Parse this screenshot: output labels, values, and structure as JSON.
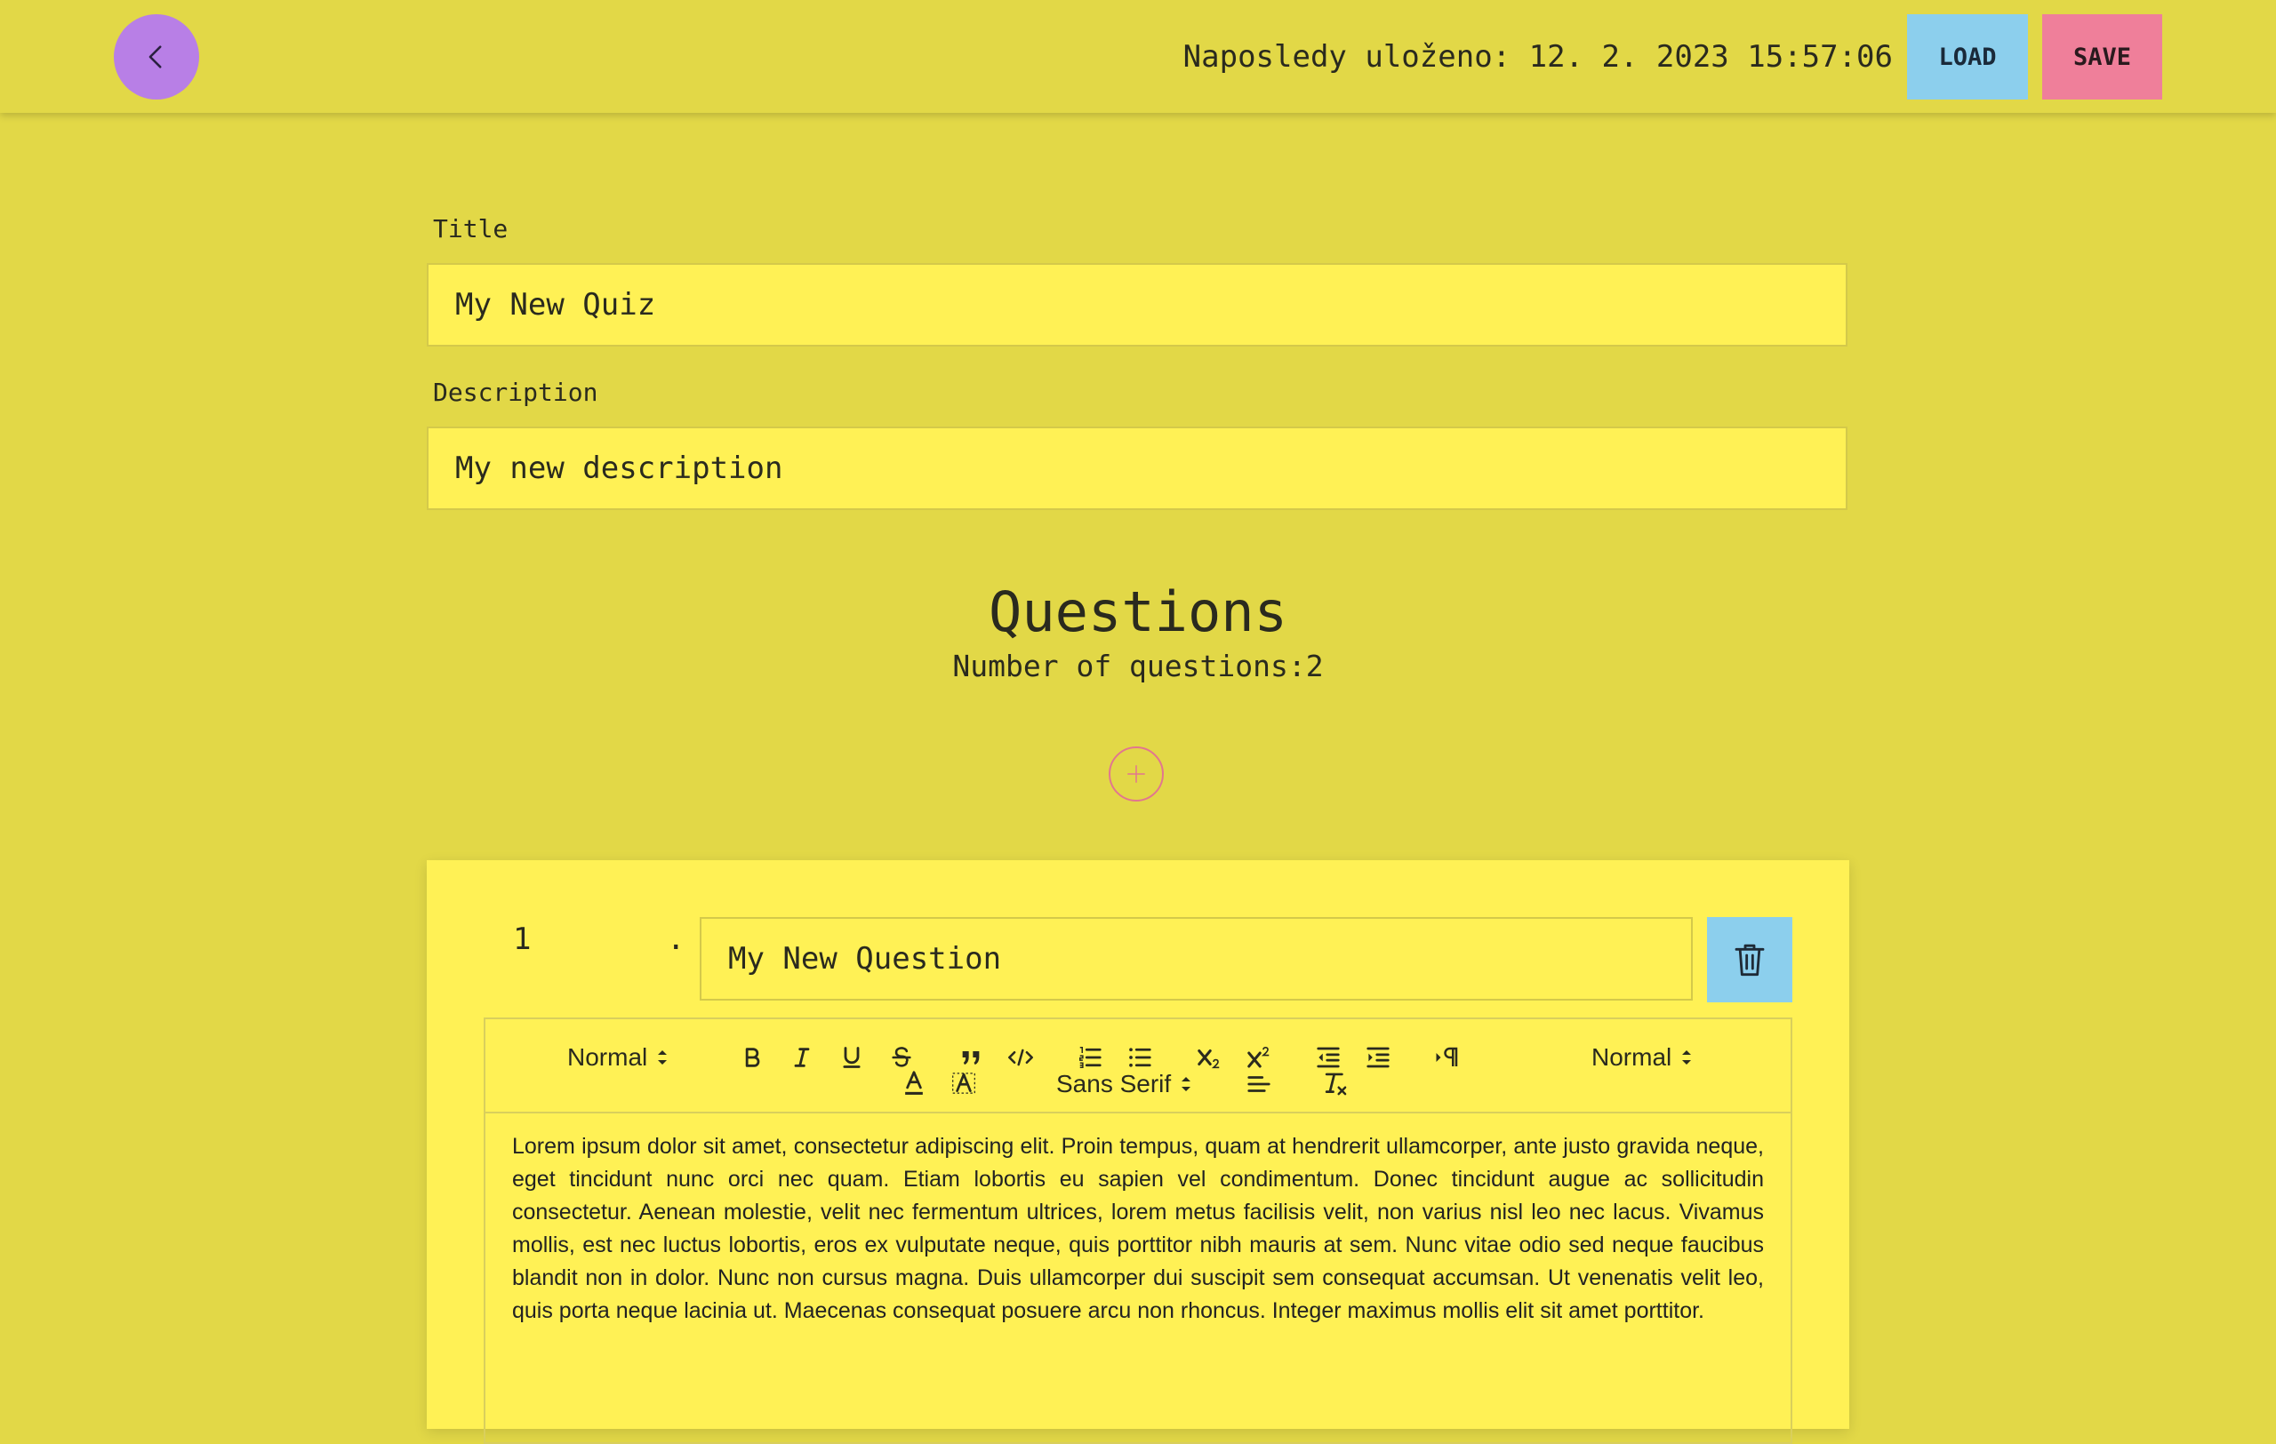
{
  "header": {
    "back_icon": "chevron-left-icon",
    "last_saved": "Naposledy uloženo: 12. 2. 2023 15:57:06",
    "load_label": "LOAD",
    "save_label": "SAVE",
    "colors": {
      "background": "#e2d847",
      "back": "#b87fe6",
      "load": "#8ccfed",
      "save": "#ef7f9a"
    }
  },
  "form": {
    "title_label": "Title",
    "title_value": "My New Quiz",
    "description_label": "Description",
    "description_value": "My new description"
  },
  "questions": {
    "heading": "Questions",
    "count_text": "Number of questions:2",
    "add_icon": "plus-icon"
  },
  "question_items": [
    {
      "number": "1",
      "dot": ".",
      "title": "My New Question",
      "delete_icon": "trash-icon",
      "toolbar": {
        "header_select": "Normal",
        "size_select": "Normal",
        "font_select": "Sans Serif",
        "icons": [
          "bold-icon",
          "italic-icon",
          "underline-icon",
          "strike-icon",
          "blockquote-icon",
          "code-block-icon",
          "ordered-list-icon",
          "bullet-list-icon",
          "subscript-icon",
          "superscript-icon",
          "outdent-icon",
          "indent-icon",
          "text-direction-icon",
          "text-color-icon",
          "background-color-icon",
          "align-icon",
          "clean-format-icon"
        ]
      },
      "body": "Lorem ipsum dolor sit amet, consectetur adipiscing elit. Proin tempus, quam at hendrerit ullamcorper, ante justo gravida neque, eget tincidunt nunc orci nec quam. Etiam lobortis eu sapien vel condimentum. Donec tincidunt augue ac sollicitudin consectetur. Aenean molestie, velit nec fermentum ultrices, lorem metus facilisis velit, non varius nisl leo nec lacus. Vivamus mollis, est nec luctus lobortis, eros ex vulputate neque, quis porttitor nibh mauris at sem. Nunc vitae odio sed neque faucibus blandit non in dolor. Nunc non cursus magna. Duis ullamcorper dui suscipit sem consequat accumsan. Ut venenatis velit leo, quis porta neque lacinia ut. Maecenas consequat posuere arcu non rhoncus. Integer maximus mollis elit sit amet porttitor."
    }
  ]
}
